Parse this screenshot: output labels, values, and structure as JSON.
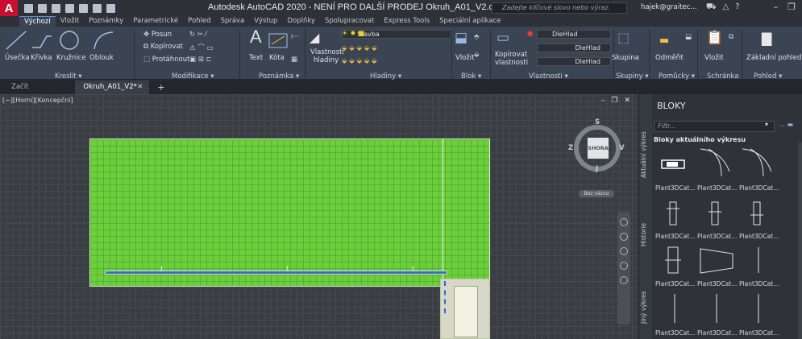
{
  "titlebar": {
    "app_logo": "A",
    "title": "Autodesk AutoCAD 2020 - NENÍ PRO DALŠÍ PRODEJ    Okruh_A01_V2.dwg",
    "search_placeholder": "Zadejte klíčové slovo nebo výraz.",
    "user": "hajek@graitec...",
    "minimize": "–",
    "restore": "❐"
  },
  "ribbon_tabs": [
    "Výchozí",
    "Vložit",
    "Poznámky",
    "Parametrické",
    "Pohled",
    "Správa",
    "Výstup",
    "Doplňky",
    "Spolupracovat",
    "Express Tools",
    "Speciální aplikace"
  ],
  "ribbon": {
    "draw": {
      "title": "Kreslit ▾",
      "line": "Úsečka",
      "polyline": "Křivka",
      "circle": "Kružnice",
      "arc": "Oblouk"
    },
    "modify": {
      "title": "Modifikace ▾",
      "move": "Posun",
      "copy": "Kopírovat",
      "stretch": "Protáhnout"
    },
    "annotation": {
      "title": "Poznámka ▾",
      "text": "Text",
      "dimension": "Kóta"
    },
    "layers": {
      "title": "Hladiny ▾",
      "properties": "Vlastnosti",
      "properties2": "hladiny",
      "current_layer": "Stavba"
    },
    "block": {
      "title": "Blok ▾",
      "insert": "Vložit"
    },
    "properties": {
      "title": "Vlastnosti ▾",
      "match": "Kopírovat",
      "match2": "vlastnosti",
      "color": "DleHlad",
      "linetype": "DleHlad",
      "lineweight": "DleHlad"
    },
    "groups": {
      "title": "Skupiny ▾",
      "group": "Skupina"
    },
    "utilities": {
      "title": "Pomůcky ▾",
      "measure": "Odměřit"
    },
    "clipboard": {
      "title": "Schránka",
      "paste": "Vložit"
    },
    "view": {
      "title": "Pohled ▾",
      "base": "Základní pohled"
    }
  },
  "doc_tabs": {
    "start": "Začít",
    "active": "Okruh_A01_V2*",
    "close": "✕",
    "new": "+"
  },
  "viewport": {
    "label": "[−][Horní][Koncepční]",
    "controls": [
      "–",
      "❐",
      "✕"
    ],
    "viewcube": {
      "face": "SHORA",
      "north": "S",
      "south": "J",
      "east": "V",
      "west": "Z",
      "ucs": "Bez názvu"
    }
  },
  "palette": {
    "title": "BLOKY",
    "filter_placeholder": "Filtr...",
    "section": "Bloky aktuálního výkresu",
    "vertical_tabs": [
      "Aktuální výkres",
      "Historie",
      "Jiný výkres"
    ],
    "blocks": [
      "Plant3DCat...",
      "Plant3DCat...",
      "Plant3DCat...",
      "Plant3DCat...",
      "Plant3DCat...",
      "Plant3DCat...",
      "Plant3DCat...",
      "Plant3DCat...",
      "Plant3DCat...",
      "Plant3DCat...",
      "Plant3DCat...",
      "Plant3DCat..."
    ]
  },
  "colors": {
    "accent": "#5a8fd0",
    "model_fill": "#6bcf3c",
    "pipe": "#3f6fa8",
    "logo": "#c8102e"
  }
}
